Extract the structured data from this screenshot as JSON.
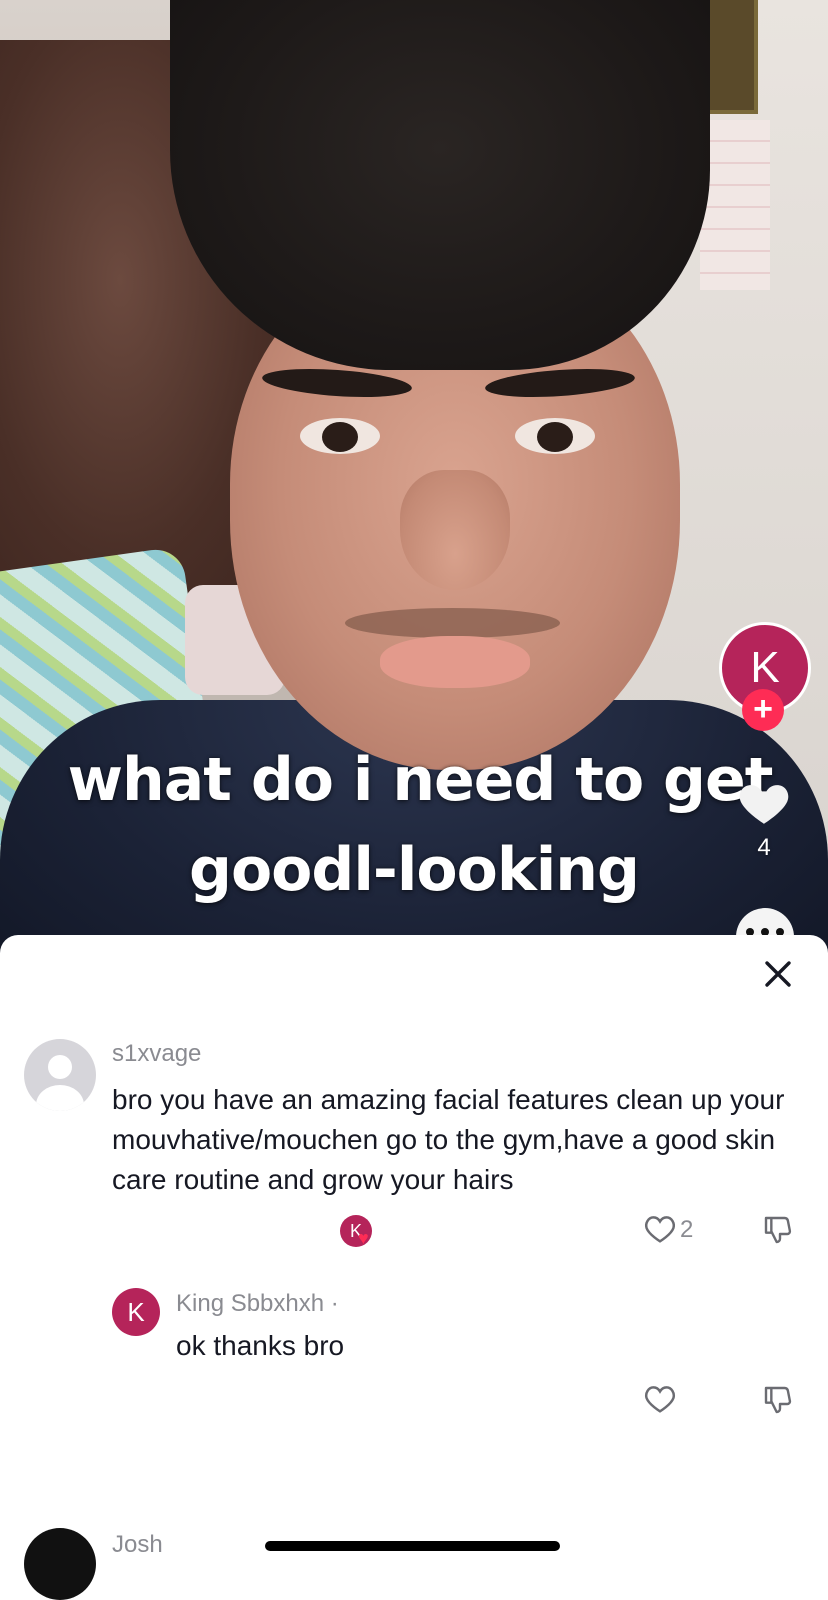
{
  "video": {
    "caption_line1": "what do i need to get",
    "caption_line2": "goodl-looking",
    "creator_avatar_letter": "K",
    "follow_icon": "plus-icon",
    "like_count": "4"
  },
  "comments": {
    "close_icon": "close-icon",
    "items": [
      {
        "username": "s1xvage",
        "text": "bro you have an amazing facial features clean up your mouvhative/mouchen go to the gym,have a good skin care routine and grow your hairs",
        "liked_by_creator_letter": "K",
        "like_count": "2",
        "replies": [
          {
            "avatar_letter": "K",
            "username": "King Sbbxhxh ·",
            "text": "ok thanks bro"
          }
        ]
      },
      {
        "username": "Josh"
      }
    ]
  },
  "colors": {
    "accent": "#fe2c55",
    "creator_avatar": "#b5245a",
    "muted_text": "#8a8b91"
  }
}
